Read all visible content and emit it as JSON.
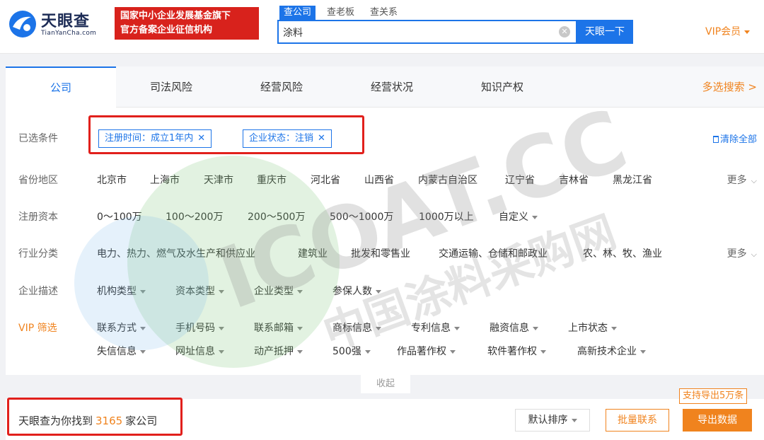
{
  "header": {
    "logo_cn": "天眼查",
    "logo_en": "TianYanCha.com",
    "badge_line1": "国家中小企业发展基金旗下",
    "badge_line2": "官方备案企业征信机构",
    "search_tabs": [
      "查公司",
      "查老板",
      "查关系"
    ],
    "search_value": "涂料",
    "search_button": "天眼一下",
    "vip_label": "VIP会员"
  },
  "category_tabs": [
    "公司",
    "司法风险",
    "经营风险",
    "经营状况",
    "知识产权"
  ],
  "multi_search": "多选搜索 >",
  "selected": {
    "label": "已选条件",
    "tags": [
      "注册时间：成立1年内",
      "企业状态：注销"
    ],
    "clear_all": "清除全部"
  },
  "province": {
    "label": "省份地区",
    "options": [
      "北京市",
      "上海市",
      "天津市",
      "重庆市",
      "河北省",
      "山西省",
      "内蒙古自治区",
      "辽宁省",
      "吉林省",
      "黑龙江省"
    ],
    "more": "更多"
  },
  "capital": {
    "label": "注册资本",
    "options": [
      "0～100万",
      "100～200万",
      "200～500万",
      "500～1000万",
      "1000万以上"
    ],
    "custom": "自定义"
  },
  "industry": {
    "label": "行业分类",
    "options": [
      "电力、热力、燃气及水生产和供应业",
      "建筑业",
      "批发和零售业",
      "交通运输、仓储和邮政业",
      "农、林、牧、渔业"
    ],
    "more": "更多"
  },
  "desc": {
    "label": "企业描述",
    "options": [
      "机构类型",
      "资本类型",
      "企业类型",
      "参保人数"
    ]
  },
  "vip_filter": {
    "label": "VIP 筛选",
    "row1": [
      "联系方式",
      "手机号码",
      "联系邮箱",
      "商标信息",
      "专利信息",
      "融资信息",
      "上市状态"
    ],
    "row2": [
      "失信信息",
      "网址信息",
      "动产抵押",
      "500强",
      "作品著作权",
      "软件著作权",
      "高新技术企业"
    ]
  },
  "collapse": "收起",
  "result": {
    "prefix": "天眼查为你找到",
    "count": "3165",
    "suffix": "家公司",
    "sort": "默认排序",
    "batch": "批量联系",
    "export": "导出数据",
    "export_tip": "支持导出5万条"
  },
  "watermark": {
    "text1": "ICOAT.CC",
    "text2": "中国涂料采购网"
  },
  "colors": {
    "primary": "#1c74e8",
    "orange": "#f0831e",
    "red": "#d8221c"
  }
}
